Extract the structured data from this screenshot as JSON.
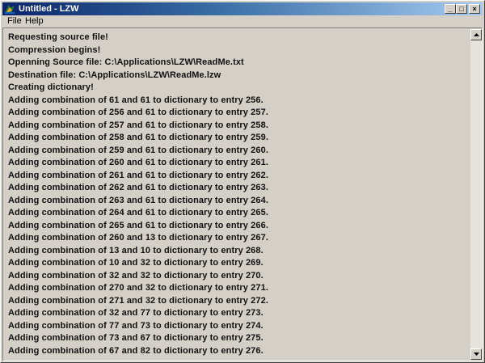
{
  "window": {
    "title": "Untitled - LZW",
    "minimize_label": "_",
    "maximize_label": "□",
    "close_label": "×"
  },
  "menu": {
    "file": "File",
    "help": "Help"
  },
  "log_lines": [
    "Requesting source file!",
    "Compression begins!",
    "Openning Source file: C:\\Applications\\LZW\\ReadMe.txt",
    "Destination file: C:\\Applications\\LZW\\ReadMe.lzw",
    "Creating dictionary!",
    "Adding combination of 61 and 61 to dictionary to entry 256.",
    "Adding combination of 256 and 61 to dictionary to entry 257.",
    "Adding combination of 257 and 61 to dictionary to entry 258.",
    "Adding combination of 258 and 61 to dictionary to entry 259.",
    "Adding combination of 259 and 61 to dictionary to entry 260.",
    "Adding combination of 260 and 61 to dictionary to entry 261.",
    "Adding combination of 261 and 61 to dictionary to entry 262.",
    "Adding combination of 262 and 61 to dictionary to entry 263.",
    "Adding combination of 263 and 61 to dictionary to entry 264.",
    "Adding combination of 264 and 61 to dictionary to entry 265.",
    "Adding combination of 265 and 61 to dictionary to entry 266.",
    "Adding combination of 260 and 13 to dictionary to entry 267.",
    "Adding combination of 13 and 10 to dictionary to entry 268.",
    "Adding combination of 10 and 32 to dictionary to entry 269.",
    "Adding combination of 32 and 32 to dictionary to entry 270.",
    "Adding combination of 270 and 32 to dictionary to entry 271.",
    "Adding combination of 271 and 32 to dictionary to entry 272.",
    "Adding combination of 32 and 77 to dictionary to entry 273.",
    "Adding combination of 77 and 73 to dictionary to entry 274.",
    "Adding combination of 73 and 67 to dictionary to entry 275.",
    "Adding combination of 67 and 82 to dictionary to entry 276."
  ]
}
